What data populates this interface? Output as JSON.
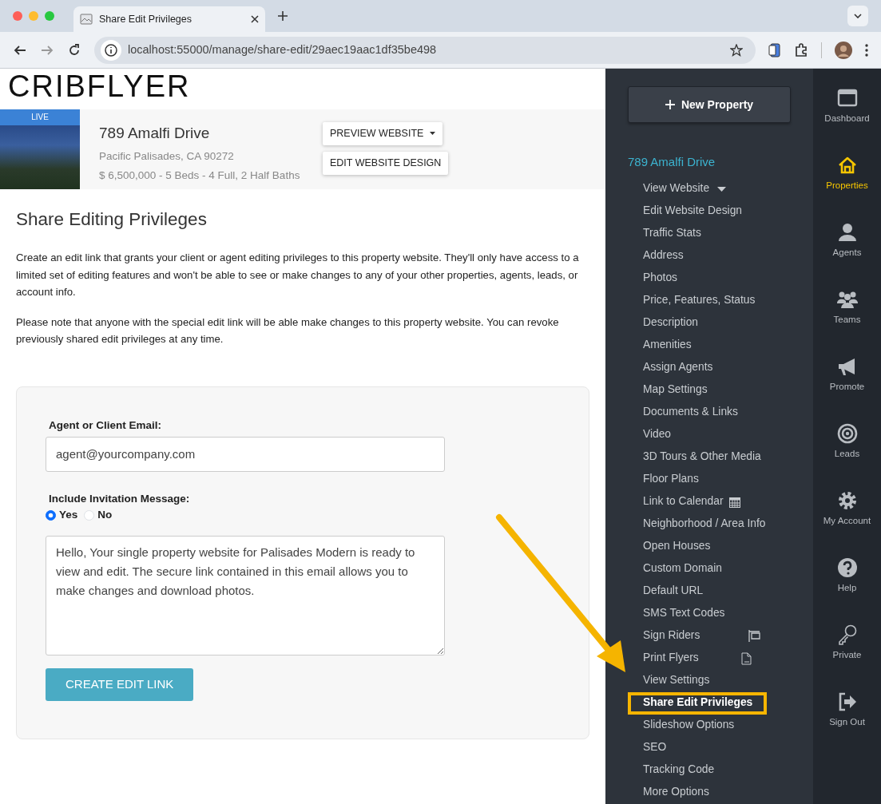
{
  "browser": {
    "tab_title": "Share Edit Privileges",
    "url": "localhost:55000/manage/share-edit/29aec19aac1df35be498"
  },
  "logo": "CRIBFLYER",
  "property": {
    "badge": "LIVE",
    "name": "789 Amalfi Drive",
    "location": "Pacific Palisades, CA 90272",
    "details": "$ 6,500,000 - 5 Beds - 4 Full, 2 Half Baths",
    "buttons": [
      {
        "label": "PREVIEW WEBSITE",
        "kind": "dropdown"
      },
      {
        "label": "EDIT WEBSITE DESIGN",
        "kind": "plain"
      }
    ]
  },
  "page": {
    "title": "Share Editing Privileges",
    "paragraphs": [
      "Create an edit link that grants your client or agent editing privileges to this property website. They'll only have access to a limited set of editing features and won't be able to see or make changes to any of your other properties, agents, leads, or account info.",
      "Please note that anyone with the special edit link will be able make changes to this property website. You can revoke previously shared edit privileges at any time."
    ]
  },
  "form": {
    "email_label": "Agent or Client Email:",
    "email": {
      "placeholder": "agent@yourcompany.com"
    },
    "message_label": "Include Invitation Message:",
    "options": [
      {
        "label": "Yes",
        "selected": true
      },
      {
        "label": "No",
        "selected": false
      }
    ],
    "message": "Hello, Your single property website for Palisades Modern is ready to view and edit. The secure link contained in this email allows you to make changes and download photos.",
    "submit": "CREATE EDIT LINK"
  },
  "sidebar": {
    "new_button": "New Property",
    "property": "789 Amalfi Drive",
    "items": [
      {
        "label": "View Website",
        "kind": "dropdown",
        "selected": false
      },
      {
        "label": "Edit Website Design",
        "kind": "link",
        "selected": false
      },
      {
        "label": "Traffic Stats",
        "kind": "link",
        "selected": false
      },
      {
        "label": "Address",
        "kind": "link",
        "selected": false
      },
      {
        "label": "Photos",
        "kind": "link",
        "selected": false
      },
      {
        "label": "Price, Features, Status",
        "kind": "link",
        "selected": false
      },
      {
        "label": "Description",
        "kind": "link",
        "selected": false
      },
      {
        "label": "Amenities",
        "kind": "link",
        "selected": false
      },
      {
        "label": "Assign Agents",
        "kind": "link",
        "selected": false
      },
      {
        "label": "Map Settings",
        "kind": "link",
        "selected": false
      },
      {
        "label": "Documents & Links",
        "kind": "link",
        "selected": false
      },
      {
        "label": "Video",
        "kind": "link",
        "selected": false
      },
      {
        "label": "3D Tours & Other Media",
        "kind": "link",
        "selected": false
      },
      {
        "label": "Floor Plans",
        "kind": "link",
        "selected": false
      },
      {
        "label": "Link to Calendar",
        "kind": "calendar",
        "selected": false
      },
      {
        "label": "Neighborhood / Area Info",
        "kind": "link",
        "selected": false
      },
      {
        "label": "Open Houses",
        "kind": "link",
        "selected": false
      },
      {
        "label": "Custom Domain",
        "kind": "link",
        "selected": false
      },
      {
        "label": "Default URL",
        "kind": "link",
        "selected": false
      },
      {
        "label": "SMS Text Codes",
        "kind": "link",
        "selected": false
      },
      {
        "label": "Sign Riders",
        "kind": "sign",
        "selected": false
      },
      {
        "label": "Print Flyers",
        "kind": "pdf",
        "selected": false
      },
      {
        "label": "View Settings",
        "kind": "link",
        "selected": false
      },
      {
        "label": "Share Edit Privileges",
        "kind": "link",
        "selected": true
      },
      {
        "label": "Slideshow Options",
        "kind": "link",
        "selected": false
      },
      {
        "label": "SEO",
        "kind": "link",
        "selected": false
      },
      {
        "label": "Tracking Code",
        "kind": "link",
        "selected": false
      },
      {
        "label": "More Options",
        "kind": "link",
        "selected": false
      }
    ]
  },
  "rail": [
    {
      "label": "Dashboard",
      "selected": false
    },
    {
      "label": "Properties",
      "selected": true
    },
    {
      "label": "Agents",
      "selected": false
    },
    {
      "label": "Teams",
      "selected": false
    },
    {
      "label": "Promote",
      "selected": false
    },
    {
      "label": "Leads",
      "selected": false
    },
    {
      "label": "My Account",
      "selected": false
    },
    {
      "label": "Help",
      "selected": false
    },
    {
      "label": "Private",
      "selected": false
    },
    {
      "label": "Sign Out",
      "selected": false
    }
  ]
}
